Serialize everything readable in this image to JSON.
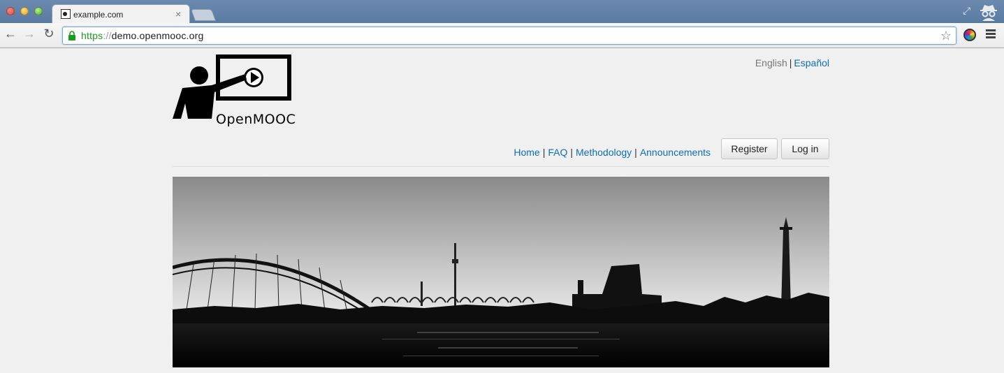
{
  "browser": {
    "tab_title": "example.com",
    "tab_close": "×",
    "url_scheme": "https",
    "url_separator": "://",
    "url_host": "demo.openmooc.org"
  },
  "page": {
    "logo_text": "OpenMOOC",
    "languages": {
      "current": "English",
      "divider": "|",
      "other": "Español"
    },
    "nav": {
      "items": [
        "Home",
        "FAQ",
        "Methodology",
        "Announcements"
      ],
      "separator": "|"
    },
    "buttons": {
      "register": "Register",
      "login": "Log in"
    }
  },
  "colors": {
    "link": "#0e6eb8",
    "secure_scheme": "#1d9b1d",
    "page_background": "#f0f0f0"
  }
}
